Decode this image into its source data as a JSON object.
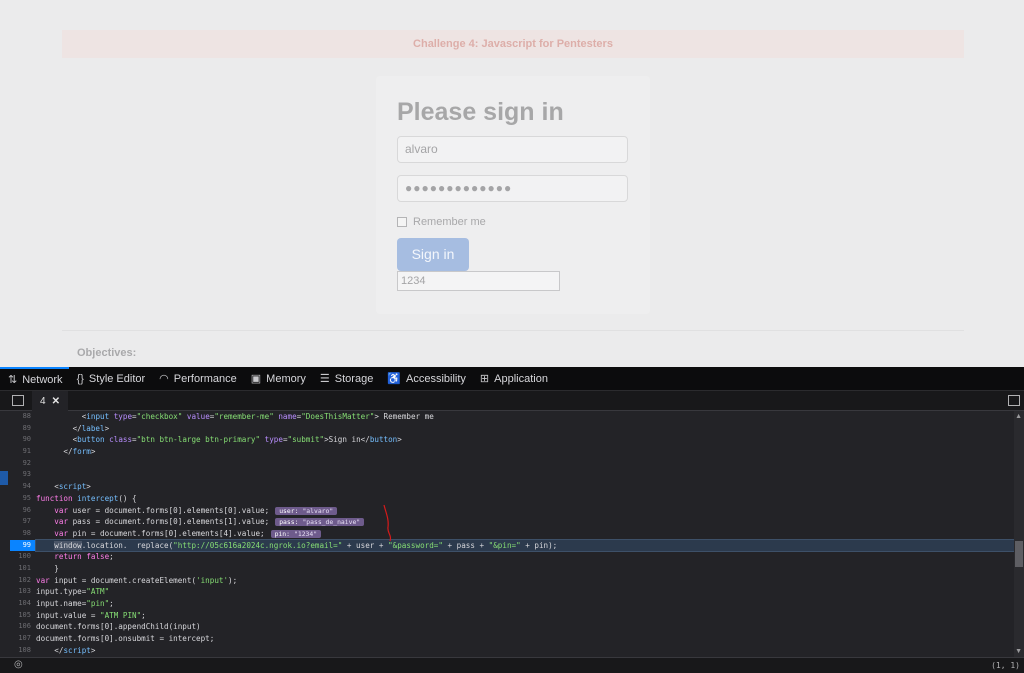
{
  "page": {
    "banner": "Challenge 4: Javascript for Pentesters",
    "form_title": "Please sign in",
    "username_value": "alvaro",
    "password_mask": "●●●●●●●●●●●●●",
    "remember_label": "Remember me",
    "signin_label": "Sign in",
    "pin_value": "1234",
    "objectives_label": "Objectives:"
  },
  "devtools": {
    "tabs": [
      {
        "label": "Network",
        "icon": "network-icon"
      },
      {
        "label": "Style Editor",
        "icon": "braces-icon"
      },
      {
        "label": "Performance",
        "icon": "gauge-icon"
      },
      {
        "label": "Memory",
        "icon": "memory-chip-icon"
      },
      {
        "label": "Storage",
        "icon": "storage-icon"
      },
      {
        "label": "Accessibility",
        "icon": "accessibility-icon"
      },
      {
        "label": "Application",
        "icon": "grid-icon"
      }
    ],
    "file_tab": "4",
    "cursor_position": "(1, 1)",
    "line_numbers": [
      "88",
      "89",
      "90",
      "91",
      "92",
      "93",
      "94",
      "95",
      "96",
      "97",
      "98",
      "99",
      "100",
      "101",
      "102",
      "103",
      "104",
      "105",
      "106",
      "107",
      "108"
    ],
    "breakpoint_line": "99",
    "previews": {
      "user_name": "user:",
      "user_val": "\"alvaro\"",
      "pass_name": "pass:",
      "pass_val": "\"pass_de_naive\"",
      "pin_name": "pin:",
      "pin_val": "\"1234\""
    }
  },
  "colors": {
    "accent": "#0a84ff",
    "paused_line": "#2c3a4d",
    "preview_chip": "#6e5b8c"
  }
}
